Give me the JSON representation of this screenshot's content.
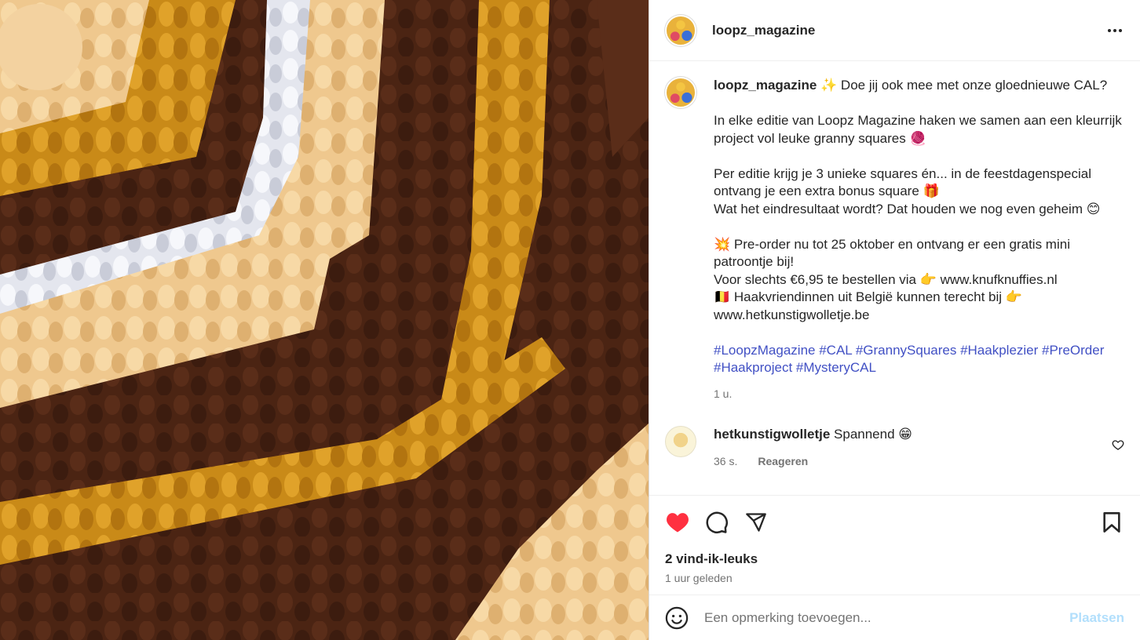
{
  "post": {
    "username": "loopz_magazine",
    "caption": {
      "username": "loopz_magazine",
      "line1": " ✨ Doe jij ook mee met onze gloednieuwe CAL?",
      "para2": "In elke editie van Loopz Magazine haken we samen aan een kleurrijk project vol leuke granny squares 🧶",
      "para3a": "Per editie krijg je 3 unieke squares én... in de feestdagenspecial ontvang je een extra bonus square 🎁",
      "para3b": "Wat het eindresultaat wordt? Dat houden we nog even geheim 😊",
      "para4a": "💥 Pre-order nu tot 25 oktober en ontvang er een gratis mini patroontje bij!",
      "para4b": "Voor slechts €6,95 te bestellen via 👉 www.knufknuffies.nl",
      "para4c": "🇧🇪 Haakvriendinnen uit België kunnen terecht bij 👉 www.hetkunstigwolletje.be",
      "hashtags": "#LoopzMagazine #CAL #GrannySquares #Haakplezier #PreOrder #Haakproject #MysteryCAL",
      "time": "1 u."
    },
    "comment": {
      "username": "hetkunstigwolletje",
      "text": " Spannend 😁",
      "time": "36 s.",
      "reply_label": "Reageren"
    },
    "likes": "2 vind-ik-leuks",
    "posted_ago": "1 uur geleden",
    "add_comment": {
      "placeholder": "Een opmerking toevoegen...",
      "post_label": "Plaatsen"
    },
    "icons": {
      "more": "more-horizontal-icon",
      "like": "heart-filled-icon",
      "comment": "comment-icon",
      "share": "share-icon",
      "save": "bookmark-icon",
      "emoji": "emoji-icon",
      "comment_like": "heart-outline-icon"
    },
    "colors": {
      "like_red": "#ff3040",
      "hashtag_blue": "#4150c4",
      "post_button_disabled": "#b2dffc"
    }
  }
}
